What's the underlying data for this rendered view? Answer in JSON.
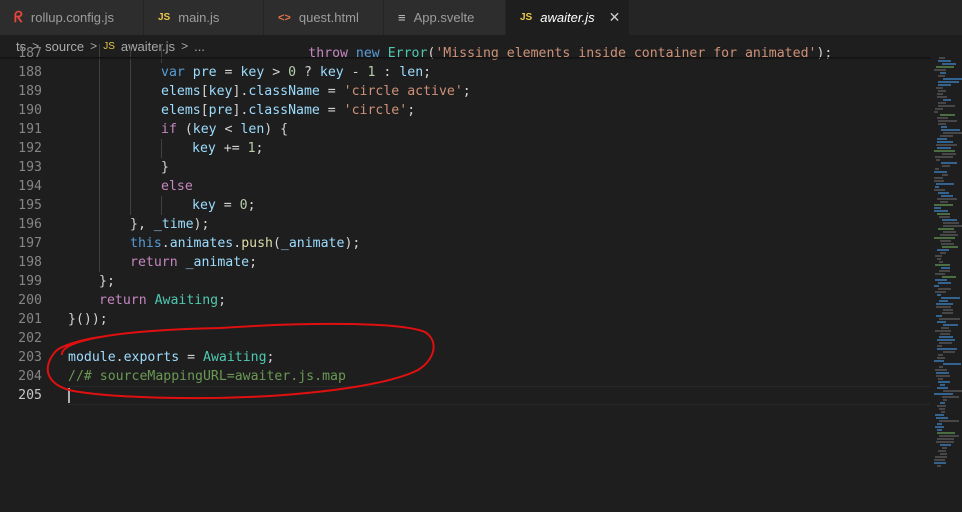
{
  "tabs": [
    {
      "label": "rollup.config.js",
      "icon": "rollup-icon",
      "glyph": "ᖇ"
    },
    {
      "label": "main.js",
      "icon": "js-icon",
      "glyph": "JS"
    },
    {
      "label": "quest.html",
      "icon": "html-icon",
      "glyph": "<>"
    },
    {
      "label": "App.svelte",
      "icon": "svelte-icon",
      "glyph": "≡"
    },
    {
      "label": "awaiter.js",
      "icon": "js-icon",
      "glyph": "JS",
      "active": true
    }
  ],
  "close_glyph": "✕",
  "breadcrumb": {
    "items": [
      "ts",
      "source",
      "awaiter.js",
      "..."
    ],
    "separator": ">",
    "file_icon_glyph": "JS"
  },
  "editor": {
    "current_line": "205",
    "lines": [
      {
        "n": "187",
        "text": "throw new Error('Missing elements inside container for animated');"
      },
      {
        "n": "188",
        "text": "var pre = key > 0 ? key - 1 : len;"
      },
      {
        "n": "189",
        "text": "elems[key].className = 'circle active';"
      },
      {
        "n": "190",
        "text": "elems[pre].className = 'circle';"
      },
      {
        "n": "191",
        "text": "if (key < len) {"
      },
      {
        "n": "192",
        "text": "key += 1;"
      },
      {
        "n": "193",
        "text": "}"
      },
      {
        "n": "194",
        "text": "else"
      },
      {
        "n": "195",
        "text": "key = 0;"
      },
      {
        "n": "196",
        "text": "}, _time);"
      },
      {
        "n": "197",
        "text": "this.animates.push(_animate);"
      },
      {
        "n": "198",
        "text": "return _animate;"
      },
      {
        "n": "199",
        "text": "};"
      },
      {
        "n": "200",
        "text": "return Awaiting;"
      },
      {
        "n": "201",
        "text": "}());"
      },
      {
        "n": "202",
        "text": ""
      },
      {
        "n": "203",
        "text": "module.exports = Awaiting;"
      },
      {
        "n": "204",
        "text": "//# sourceMappingURL=awaiter.js.map"
      },
      {
        "n": "205",
        "text": ""
      }
    ]
  },
  "colors": {
    "annotation": "#e01010",
    "background": "#1e1e1e",
    "tab_bar": "#252526"
  }
}
